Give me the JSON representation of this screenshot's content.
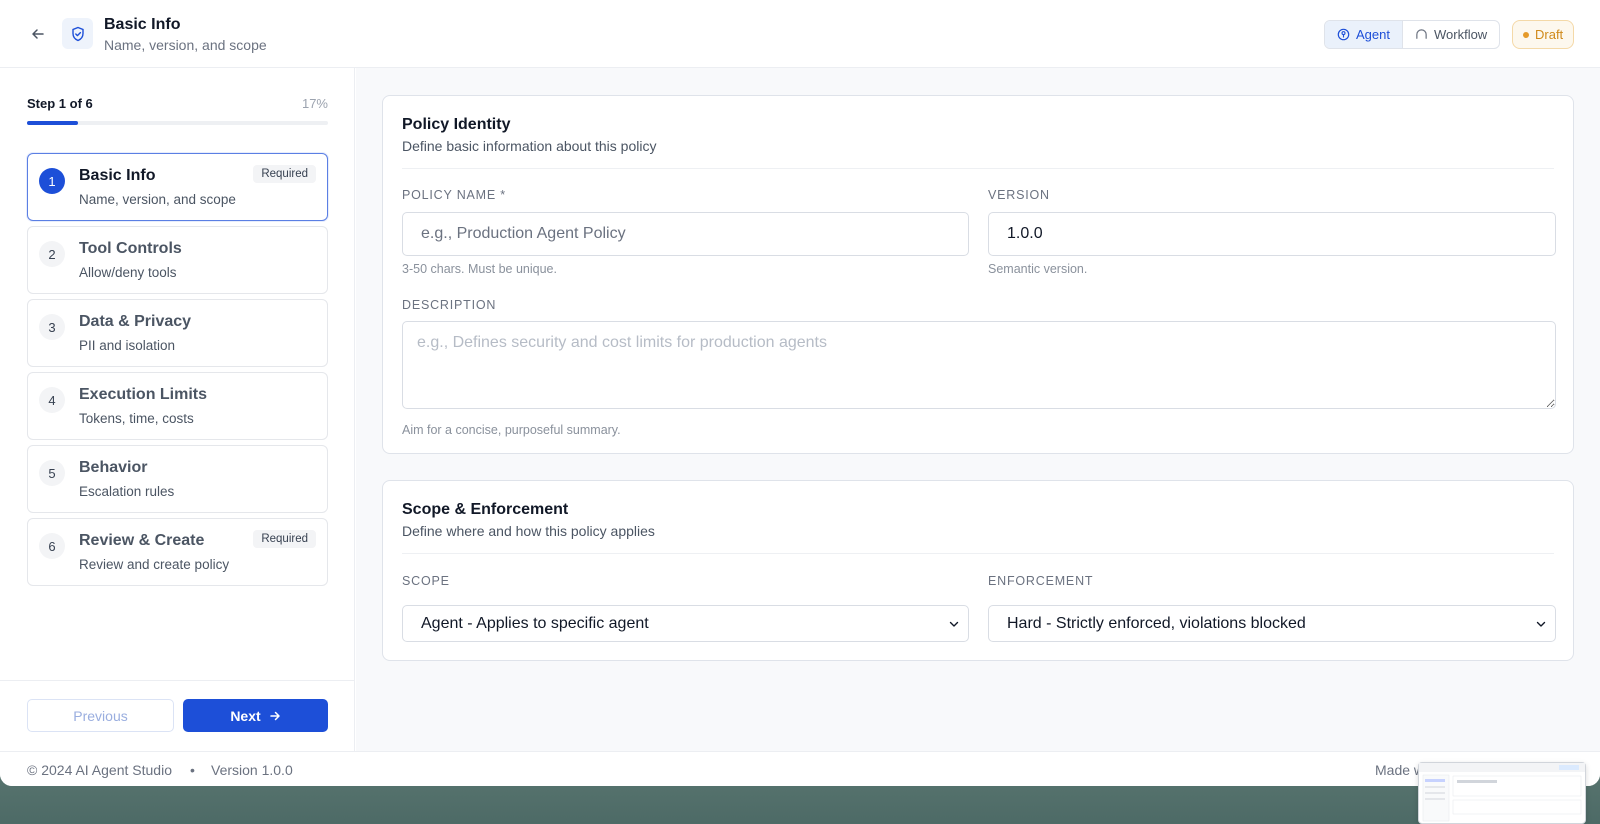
{
  "header": {
    "title": "Basic Info",
    "subtitle": "Name, version, and scope",
    "modes": [
      "Agent",
      "Workflow"
    ],
    "active_mode": "Agent",
    "status": "Draft"
  },
  "sidebar": {
    "step_label": "Step 1 of 6",
    "percent_label": "17%",
    "progress": 0.17,
    "steps": [
      {
        "num": "1",
        "title": "Basic Info",
        "desc": "Name, version, and scope",
        "badge": "Required"
      },
      {
        "num": "2",
        "title": "Tool Controls",
        "desc": "Allow/deny tools",
        "badge": ""
      },
      {
        "num": "3",
        "title": "Data & Privacy",
        "desc": "PII and isolation",
        "badge": ""
      },
      {
        "num": "4",
        "title": "Execution Limits",
        "desc": "Tokens, time, costs",
        "badge": ""
      },
      {
        "num": "5",
        "title": "Behavior",
        "desc": "Escalation rules",
        "badge": ""
      },
      {
        "num": "6",
        "title": "Review & Create",
        "desc": "Review and create policy",
        "badge": "Required"
      }
    ],
    "previous_label": "Previous",
    "next_label": "Next"
  },
  "identity": {
    "title": "Policy Identity",
    "subtitle": "Define basic information about this policy",
    "name_label": "POLICY NAME *",
    "name_placeholder": "e.g., Production Agent Policy",
    "name_hint": "3-50 chars. Must be unique.",
    "version_label": "VERSION",
    "version_value": "1.0.0",
    "version_hint": "Semantic version.",
    "description_label": "DESCRIPTION",
    "description_placeholder": "e.g., Defines security and cost limits for production agents",
    "description_hint": "Aim for a concise, purposeful summary."
  },
  "scope": {
    "title": "Scope & Enforcement",
    "subtitle": "Define where and how this policy applies",
    "scope_label": "SCOPE",
    "scope_value": "Agent - Applies to specific agent",
    "enforcement_label": "ENFORCEMENT",
    "enforcement_value": "Hard - Strictly enforced, violations blocked"
  },
  "footer": {
    "copyright": "© 2024 AI Agent Studio",
    "separator": "•",
    "version": "Version 1.0.0",
    "made_with": "Made w"
  },
  "colors": {
    "accent": "#1d4fd8",
    "draft": "#d08a1a"
  }
}
